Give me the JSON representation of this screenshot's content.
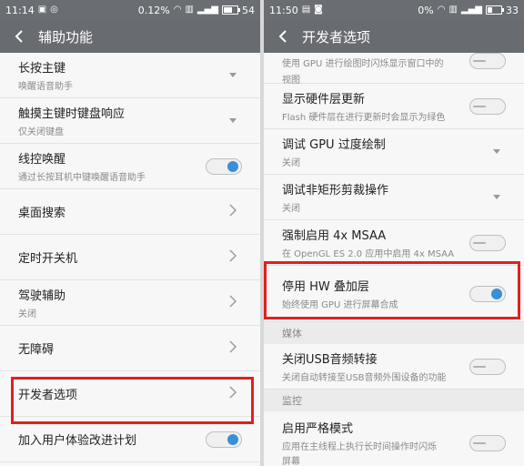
{
  "left": {
    "status": {
      "time": "11:14",
      "network_speed": "0.12",
      "speed_unit": "%",
      "battery": "54",
      "battery_level": 0.54
    },
    "title": "辅助功能",
    "items": [
      {
        "title": "长按主键",
        "subtitle": "唤醒语音助手",
        "control": "dropdown"
      },
      {
        "title": "触摸主键时键盘响应",
        "subtitle": "仅关闭键盘",
        "control": "dropdown"
      },
      {
        "title": "线控唤醒",
        "subtitle": "通过长按耳机中键唤醒语音助手",
        "control": "toggle-on"
      },
      {
        "title": "桌面搜索",
        "subtitle": "",
        "control": "arrow"
      },
      {
        "title": "定时开关机",
        "subtitle": "",
        "control": "arrow"
      },
      {
        "title": "驾驶辅助",
        "subtitle": "关闭",
        "control": "arrow"
      },
      {
        "title": "无障碍",
        "subtitle": "",
        "control": "arrow"
      },
      {
        "title": "开发者选项",
        "subtitle": "",
        "control": "arrow"
      },
      {
        "title": "加入用户体验改进计划",
        "subtitle": "",
        "control": "toggle-on"
      }
    ]
  },
  "right": {
    "status": {
      "time": "11:50",
      "network_speed": "0",
      "speed_unit": "%",
      "battery": "33",
      "battery_level": 0.33
    },
    "title": "开发者选项",
    "partial_item": {
      "subtitle_line1": "使用 GPU 进行绘图时闪烁显示窗口中的",
      "subtitle_line2": "视图"
    },
    "items": [
      {
        "title": "显示硬件层更新",
        "subtitle": "Flash 硬件层在进行更新时会显示为绿色",
        "control": "toggle-off"
      },
      {
        "title": "调试 GPU 过度绘制",
        "subtitle": "关闭",
        "control": "dropdown"
      },
      {
        "title": "调试非矩形剪裁操作",
        "subtitle": "关闭",
        "control": "dropdown"
      },
      {
        "title": "强制启用 4x MSAA",
        "subtitle": "在 OpenGL ES 2.0 应用中启用 4x MSAA",
        "control": "toggle-off"
      },
      {
        "title": "停用 HW 叠加层",
        "subtitle": "始终使用 GPU 进行屏幕合成",
        "control": "toggle-on"
      }
    ],
    "section_media": "媒体",
    "media_item": {
      "title": "关闭USB音频转接",
      "subtitle": "关闭自动转接至USB音频外围设备的功能",
      "control": "toggle-off"
    },
    "section_monitor": "监控",
    "monitor_item": {
      "title": "启用严格模式",
      "subtitle": "应用在主线程上执行长时间操作时闪烁",
      "subtitle_line2": "屏幕",
      "control": "toggle-off"
    }
  }
}
